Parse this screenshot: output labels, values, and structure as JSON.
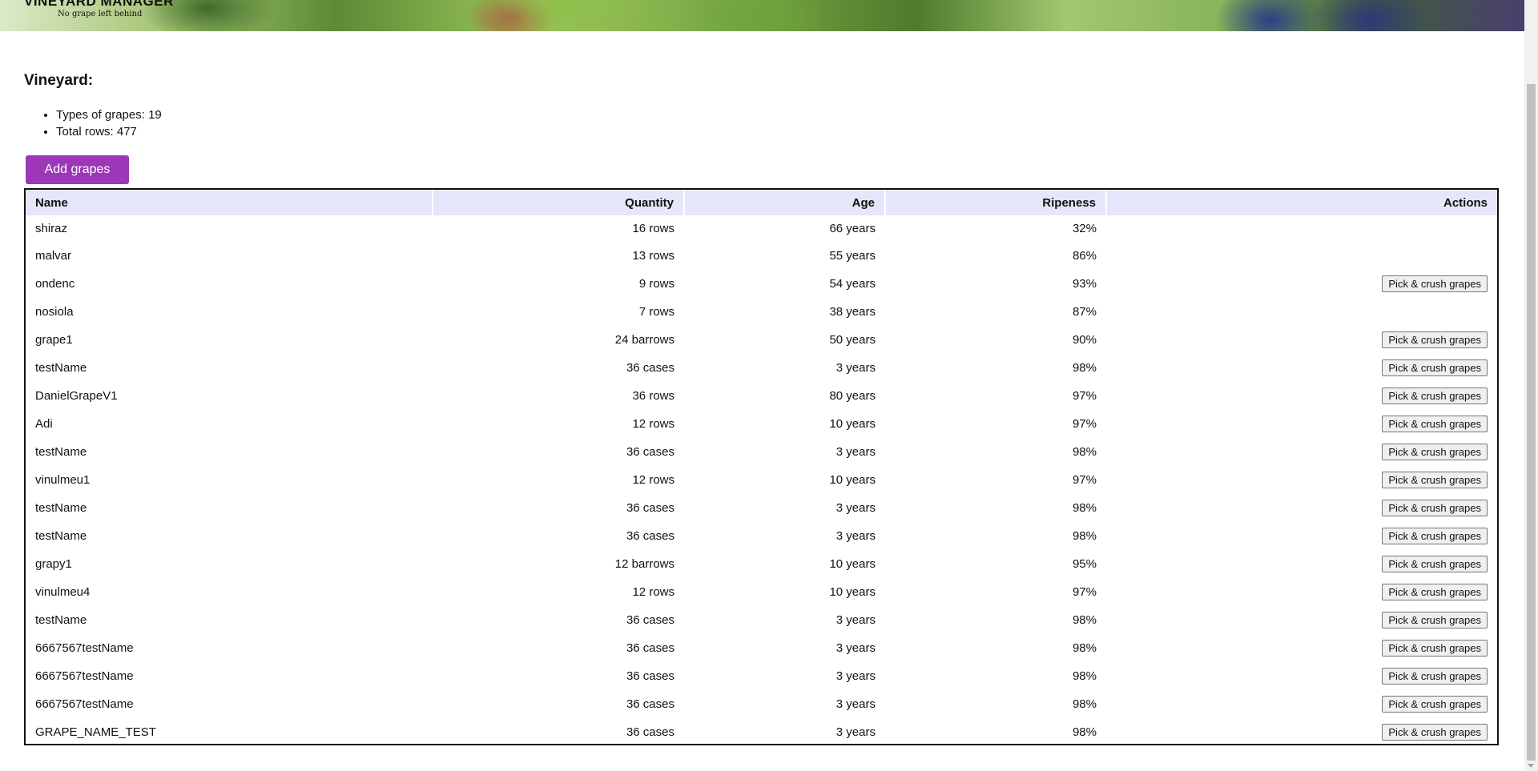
{
  "header": {
    "title": "VINEYARD MANAGER",
    "tagline": "No grape left behind"
  },
  "vineyard": {
    "heading": "Vineyard:",
    "stats": [
      "Types of grapes: 19",
      "Total rows: 477"
    ],
    "add_button_label": "Add grapes",
    "accent_color": "#9c38b7"
  },
  "table": {
    "header_bg": "#e6e6fa",
    "columns": [
      "Name",
      "Quantity",
      "Age",
      "Ripeness",
      "Actions"
    ],
    "action_label": "Pick & crush grapes",
    "rows": [
      {
        "name": "shiraz",
        "quantity": "16 rows",
        "age": "66 years",
        "ripeness": "32%",
        "action": false
      },
      {
        "name": "malvar",
        "quantity": "13 rows",
        "age": "55 years",
        "ripeness": "86%",
        "action": false
      },
      {
        "name": "ondenc",
        "quantity": "9 rows",
        "age": "54 years",
        "ripeness": "93%",
        "action": true
      },
      {
        "name": "nosiola",
        "quantity": "7 rows",
        "age": "38 years",
        "ripeness": "87%",
        "action": false
      },
      {
        "name": "grape1",
        "quantity": "24 barrows",
        "age": "50 years",
        "ripeness": "90%",
        "action": true
      },
      {
        "name": "testName",
        "quantity": "36 cases",
        "age": "3 years",
        "ripeness": "98%",
        "action": true
      },
      {
        "name": "DanielGrapeV1",
        "quantity": "36 rows",
        "age": "80 years",
        "ripeness": "97%",
        "action": true
      },
      {
        "name": "Adi",
        "quantity": "12 rows",
        "age": "10 years",
        "ripeness": "97%",
        "action": true
      },
      {
        "name": "testName",
        "quantity": "36 cases",
        "age": "3 years",
        "ripeness": "98%",
        "action": true
      },
      {
        "name": "vinulmeu1",
        "quantity": "12 rows",
        "age": "10 years",
        "ripeness": "97%",
        "action": true
      },
      {
        "name": "testName",
        "quantity": "36 cases",
        "age": "3 years",
        "ripeness": "98%",
        "action": true
      },
      {
        "name": "testName",
        "quantity": "36 cases",
        "age": "3 years",
        "ripeness": "98%",
        "action": true
      },
      {
        "name": "grapy1",
        "quantity": "12 barrows",
        "age": "10 years",
        "ripeness": "95%",
        "action": true
      },
      {
        "name": "vinulmeu4",
        "quantity": "12 rows",
        "age": "10 years",
        "ripeness": "97%",
        "action": true
      },
      {
        "name": "testName",
        "quantity": "36 cases",
        "age": "3 years",
        "ripeness": "98%",
        "action": true
      },
      {
        "name": "6667567testName",
        "quantity": "36 cases",
        "age": "3 years",
        "ripeness": "98%",
        "action": true
      },
      {
        "name": "6667567testName",
        "quantity": "36 cases",
        "age": "3 years",
        "ripeness": "98%",
        "action": true
      },
      {
        "name": "6667567testName",
        "quantity": "36 cases",
        "age": "3 years",
        "ripeness": "98%",
        "action": true
      },
      {
        "name": "GRAPE_NAME_TEST",
        "quantity": "36 cases",
        "age": "3 years",
        "ripeness": "98%",
        "action": true
      }
    ]
  }
}
